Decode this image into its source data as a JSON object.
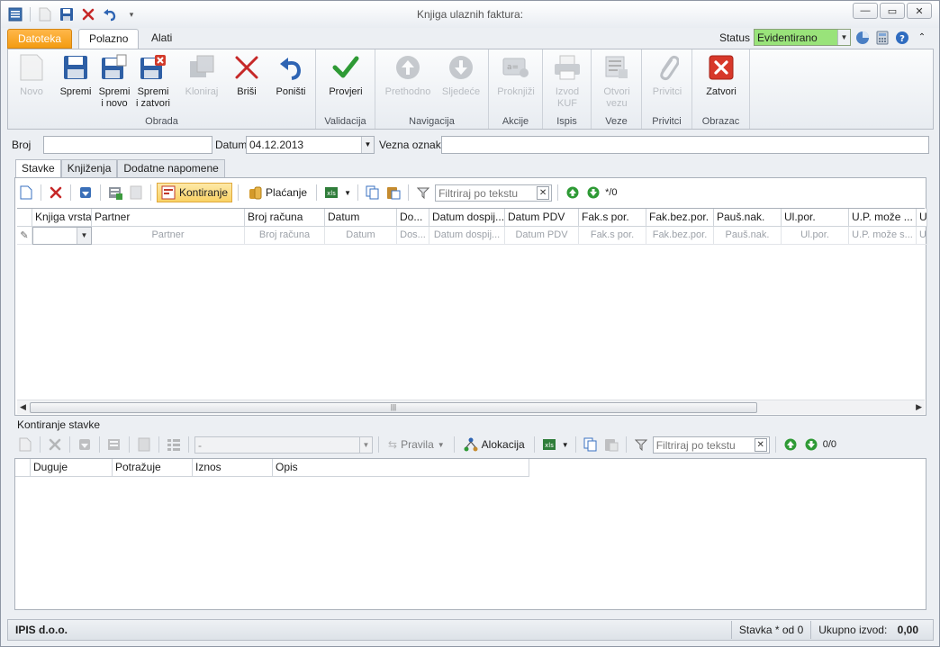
{
  "window": {
    "title": "Knjiga ulaznih faktura:"
  },
  "ribbon_tabs": [
    "Datoteka",
    "Polazno",
    "Alati"
  ],
  "status": {
    "label": "Status",
    "value": "Evidentirano"
  },
  "ribbon": {
    "groups": [
      {
        "label": "Obrada"
      },
      {
        "label": "Validacija"
      },
      {
        "label": "Navigacija"
      },
      {
        "label": "Akcije"
      },
      {
        "label": "Ispis"
      },
      {
        "label": "Veze"
      },
      {
        "label": "Privitci"
      },
      {
        "label": "Obrazac"
      }
    ],
    "buttons": {
      "novo": "Novo",
      "spremi": "Spremi",
      "spremi_novo": "Spremi i novo",
      "spremi_zatvori": "Spremi i zatvori",
      "kloniraj": "Kloniraj",
      "brisi": "Briši",
      "ponisti": "Poništi",
      "provjeri": "Provjeri",
      "prethodno": "Prethodno",
      "sljedece": "Sljedeće",
      "proknjizi": "Proknjiži",
      "izvod_kuf": "Izvod KUF",
      "otvori_vezu": "Otvori vezu",
      "privitci": "Privitci",
      "zatvori": "Zatvori"
    }
  },
  "form": {
    "broj_label": "Broj",
    "broj_value": "",
    "datum_label": "Datum",
    "datum_value": "04.12.2013",
    "vezna_label": "Vezna oznaka",
    "vezna_value": ""
  },
  "page_tabs": [
    "Stavke",
    "Knjiženja",
    "Dodatne napomene"
  ],
  "stavke_toolbar": {
    "kontiranje": "Kontiranje",
    "placanje": "Plaćanje",
    "filter_placeholder": "Filtriraj po tekstu",
    "counter": "*/0"
  },
  "stavke_grid": {
    "columns": [
      "Knjiga vrsta",
      "Partner",
      "Broj računa",
      "Datum",
      "Do...",
      "Datum dospij...",
      "Datum PDV",
      "Fak.s por.",
      "Fak.bez.por.",
      "Pauš.nak.",
      "Ul.por.",
      "U.P. može ...",
      "U"
    ],
    "new_row_placeholders": [
      "",
      "Partner",
      "Broj računa",
      "Datum",
      "Dos...",
      "Datum dospij...",
      "Datum PDV",
      "Fak.s por.",
      "Fak.bez.por.",
      "Pauš.nak.",
      "Ul.por.",
      "U.P. može s...",
      "U"
    ]
  },
  "kontiranje_section": {
    "title": "Kontiranje stavke",
    "combo_value": "-",
    "pravila": "Pravila",
    "alokacija": "Alokacija",
    "filter_placeholder": "Filtriraj po tekstu",
    "counter": "0/0",
    "columns": [
      "Duguje",
      "Potražuje",
      "Iznos",
      "Opis"
    ]
  },
  "statusbar": {
    "company": "IPIS d.o.o.",
    "stavka": "Stavka * od 0",
    "ukupno_label": "Ukupno izvod:",
    "ukupno_value": "0,00"
  }
}
